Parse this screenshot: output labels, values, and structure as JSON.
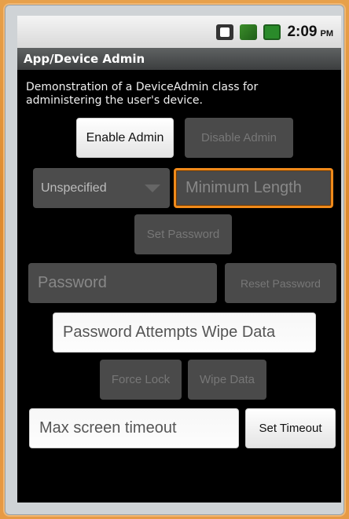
{
  "status_bar": {
    "time": "2:09",
    "ampm": "PM",
    "icons": [
      "data-icon",
      "signal-icon",
      "battery-icon"
    ]
  },
  "title_bar": {
    "title": "App/Device Admin"
  },
  "description": "Demonstration of a DeviceAdmin class for administering the user's device.",
  "buttons": {
    "enable_admin": "Enable Admin",
    "disable_admin": "Disable Admin",
    "set_password": "Set Password",
    "reset_password": "Reset Password",
    "force_lock": "Force Lock",
    "wipe_data": "Wipe Data",
    "set_timeout": "Set Timeout"
  },
  "spinner": {
    "selected": "Unspecified"
  },
  "fields": {
    "minimum_length_placeholder": "Minimum Length",
    "password_placeholder": "Password",
    "password_attempts_placeholder": "Password Attempts Wipe Data",
    "max_timeout_placeholder": "Max screen timeout"
  },
  "colors": {
    "focus_accent": "#f08a1a",
    "frame_background": "#e7a04a"
  }
}
